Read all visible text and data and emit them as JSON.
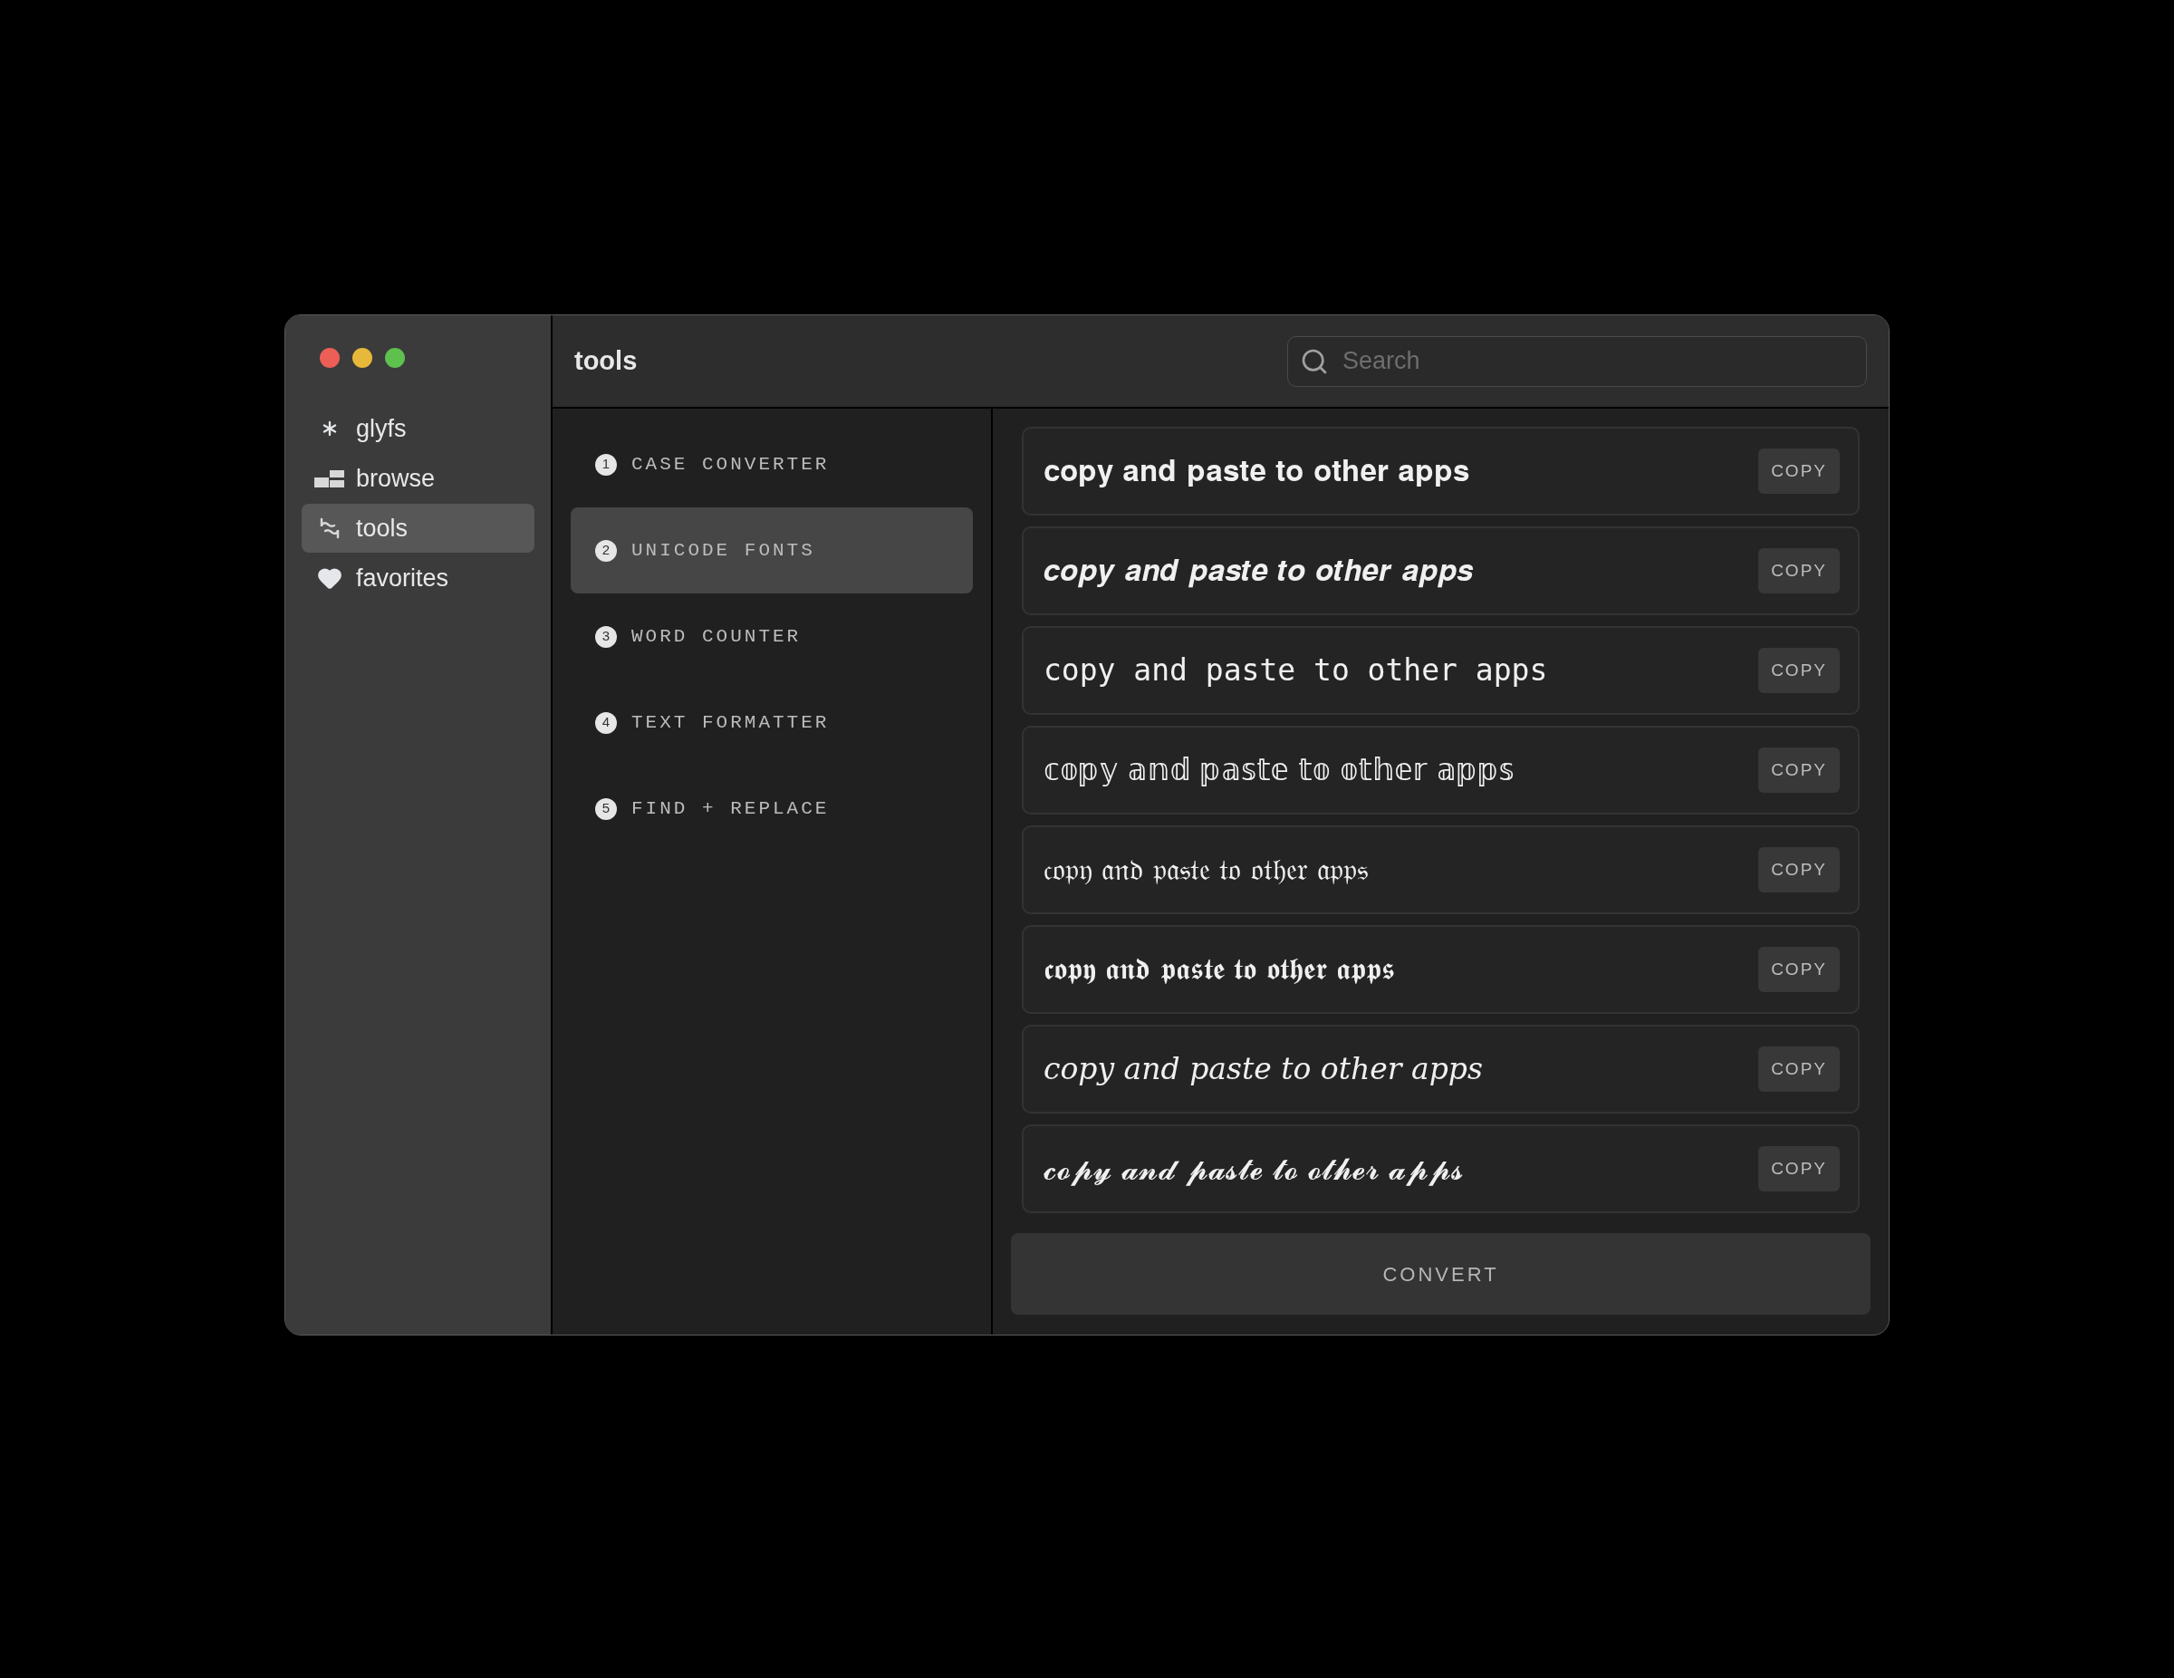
{
  "window": {
    "title": "tools"
  },
  "search": {
    "placeholder": "Search"
  },
  "sidebar": {
    "items": [
      {
        "label": "glyfs",
        "selected": false
      },
      {
        "label": "browse",
        "selected": false
      },
      {
        "label": "tools",
        "selected": true
      },
      {
        "label": "favorites",
        "selected": false
      }
    ]
  },
  "tools": [
    {
      "number": "1",
      "label": "CASE CONVERTER",
      "selected": false
    },
    {
      "number": "2",
      "label": "UNICODE FONTS",
      "selected": true
    },
    {
      "number": "3",
      "label": "WORD COUNTER",
      "selected": false
    },
    {
      "number": "4",
      "label": "TEXT FORMATTER",
      "selected": false
    },
    {
      "number": "5",
      "label": "FIND + REPLACE",
      "selected": false
    }
  ],
  "results": [
    {
      "text": "𝐜𝐨𝐩𝐲 𝐚𝐧𝐝 𝐩𝐚𝐬𝐭𝐞 𝐭𝐨 𝐨𝐭𝐡𝐞𝐫 𝐚𝐩𝐩𝐬",
      "button": "COPY"
    },
    {
      "text": "𝒄𝒐𝒑𝒚 𝒂𝒏𝒅 𝒑𝒂𝒔𝒕𝒆 𝒕𝒐 𝒐𝒕𝒉𝒆𝒓 𝒂𝒑𝒑𝒔",
      "button": "COPY"
    },
    {
      "text": "𝚌𝚘𝚙𝚢 𝚊𝚗𝚍 𝚙𝚊𝚜𝚝𝚎 𝚝𝚘 𝚘𝚝𝚑𝚎𝚛 𝚊𝚙𝚙𝚜",
      "button": "COPY"
    },
    {
      "text": "𝕔𝕠𝕡𝕪 𝕒𝕟𝕕 𝕡𝕒𝕤𝕥𝕖 𝕥𝕠 𝕠𝕥𝕙𝕖𝕣 𝕒𝕡𝕡𝕤",
      "button": "COPY"
    },
    {
      "text": "𝔠𝔬𝔭𝔶 𝔞𝔫𝔡 𝔭𝔞𝔰𝔱𝔢 𝔱𝔬 𝔬𝔱𝔥𝔢𝔯 𝔞𝔭𝔭𝔰",
      "button": "COPY"
    },
    {
      "text": "𝖈𝖔𝖕𝖞 𝖆𝖓𝖉 𝖕𝖆𝖘𝖙𝖊 𝖙𝖔 𝖔𝖙𝖍𝖊𝖗 𝖆𝖕𝖕𝖘",
      "button": "COPY"
    },
    {
      "text": "𝑐𝑜𝑝𝑦 𝑎𝑛𝑑 𝑝𝑎𝑠𝑡𝑒 𝑡𝑜 𝑜𝑡ℎ𝑒𝑟 𝑎𝑝𝑝𝑠",
      "button": "COPY"
    },
    {
      "text": "𝓬𝓸𝓹𝔂 𝓪𝓷𝓭 𝓹𝓪𝓼𝓽𝓮 𝓽𝓸 𝓸𝓽𝓱𝓮𝓻 𝓪𝓹𝓹𝓼",
      "button": "COPY"
    }
  ],
  "convert_button": "CONVERT"
}
